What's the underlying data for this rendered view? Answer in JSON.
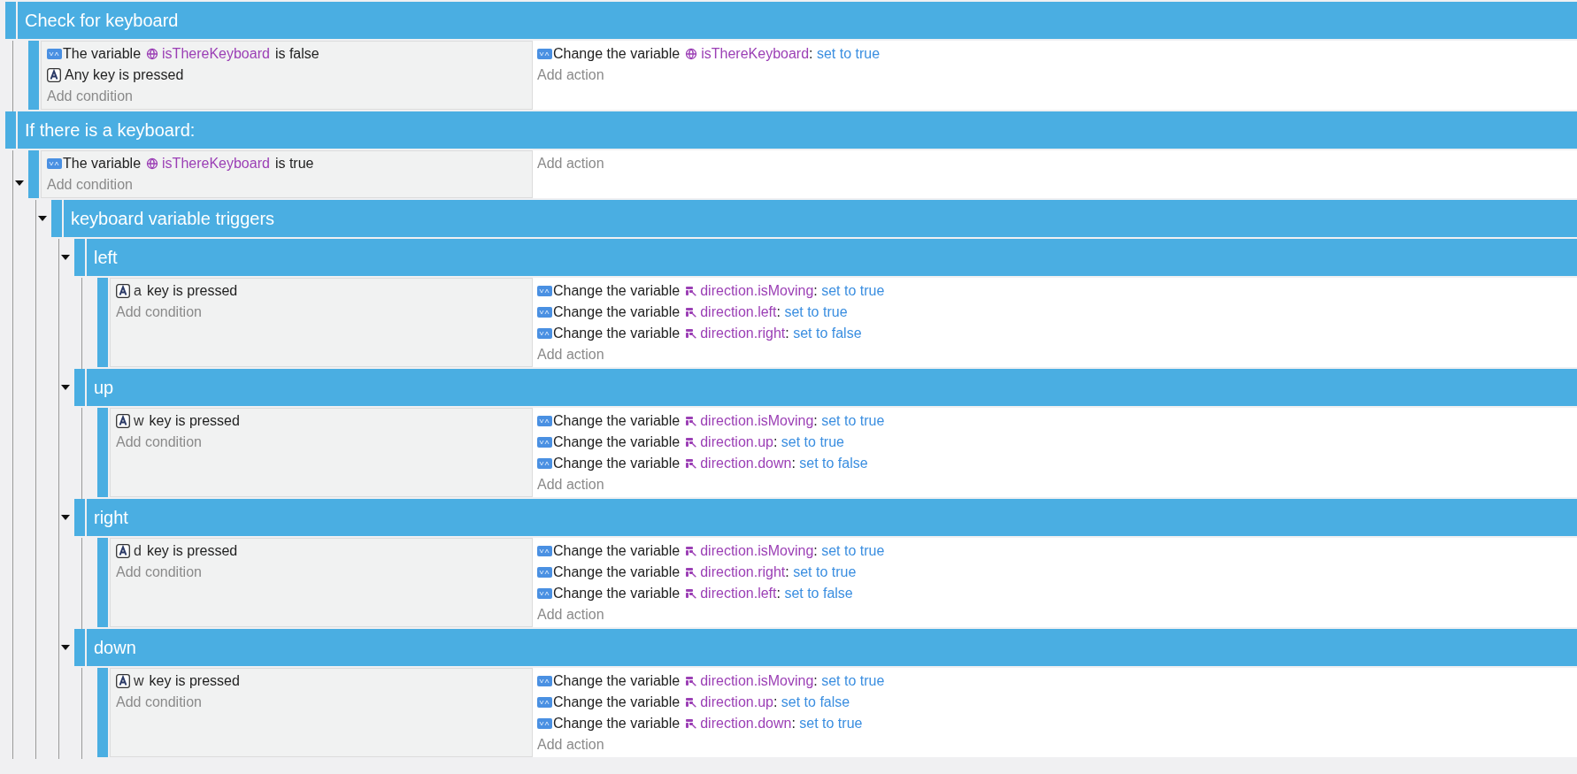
{
  "events": [
    {
      "kind": "group",
      "title": "Check for keyboard",
      "children": [
        {
          "kind": "event",
          "conditions": [
            {
              "kind": "variable",
              "prefix": "The variable",
              "variable": "isThereKeyboard",
              "suffix": "is false"
            },
            {
              "kind": "key",
              "text": "Any key is pressed"
            }
          ],
          "actions": [
            {
              "kind": "global",
              "prefix": "Change the variable",
              "variable": "isThereKeyboard",
              "colon": ":",
              "value": "set to true"
            }
          ],
          "add_condition": "Add condition",
          "add_action": "Add action"
        }
      ]
    },
    {
      "kind": "group",
      "title": "If there is a keyboard:",
      "children": [
        {
          "kind": "event",
          "expanded": true,
          "conditions": [
            {
              "kind": "variable",
              "prefix": "The variable",
              "variable": "isThereKeyboard",
              "suffix": "is true"
            }
          ],
          "add_condition": "Add condition",
          "add_action": "Add action",
          "children": [
            {
              "kind": "group",
              "expanded": true,
              "title": "keyboard variable triggers",
              "children": [
                {
                  "kind": "group",
                  "expanded": true,
                  "title": "left",
                  "children": [
                    {
                      "kind": "event",
                      "conditions": [
                        {
                          "kind": "key",
                          "key": "a",
                          "text": "key is pressed"
                        }
                      ],
                      "actions": [
                        {
                          "kind": "structure",
                          "prefix": "Change the variable",
                          "variable": "direction.isMoving",
                          "colon": ":",
                          "value": "set to true"
                        },
                        {
                          "kind": "structure",
                          "prefix": "Change the variable",
                          "variable": "direction.left",
                          "colon": ":",
                          "value": "set to true"
                        },
                        {
                          "kind": "structure",
                          "prefix": "Change the variable",
                          "variable": "direction.right",
                          "colon": ":",
                          "value": "set to false"
                        }
                      ],
                      "add_condition": "Add condition",
                      "add_action": "Add action"
                    }
                  ]
                },
                {
                  "kind": "group",
                  "expanded": true,
                  "title": "up",
                  "children": [
                    {
                      "kind": "event",
                      "conditions": [
                        {
                          "kind": "key",
                          "key": "w",
                          "text": "key is pressed"
                        }
                      ],
                      "actions": [
                        {
                          "kind": "structure",
                          "prefix": "Change the variable",
                          "variable": "direction.isMoving",
                          "colon": ":",
                          "value": "set to true"
                        },
                        {
                          "kind": "structure",
                          "prefix": "Change the variable",
                          "variable": "direction.up",
                          "colon": ":",
                          "value": "set to true"
                        },
                        {
                          "kind": "structure",
                          "prefix": "Change the variable",
                          "variable": "direction.down",
                          "colon": ":",
                          "value": "set to false"
                        }
                      ],
                      "add_condition": "Add condition",
                      "add_action": "Add action"
                    }
                  ]
                },
                {
                  "kind": "group",
                  "expanded": true,
                  "title": "right",
                  "children": [
                    {
                      "kind": "event",
                      "conditions": [
                        {
                          "kind": "key",
                          "key": "d",
                          "text": "key is pressed"
                        }
                      ],
                      "actions": [
                        {
                          "kind": "structure",
                          "prefix": "Change the variable",
                          "variable": "direction.isMoving",
                          "colon": ":",
                          "value": "set to true"
                        },
                        {
                          "kind": "structure",
                          "prefix": "Change the variable",
                          "variable": "direction.right",
                          "colon": ":",
                          "value": "set to true"
                        },
                        {
                          "kind": "structure",
                          "prefix": "Change the variable",
                          "variable": "direction.left",
                          "colon": ":",
                          "value": "set to false"
                        }
                      ],
                      "add_condition": "Add condition",
                      "add_action": "Add action"
                    }
                  ]
                },
                {
                  "kind": "group",
                  "expanded": true,
                  "title": "down",
                  "children": [
                    {
                      "kind": "event",
                      "conditions": [
                        {
                          "kind": "key",
                          "key": "w",
                          "text": "key is pressed"
                        }
                      ],
                      "actions": [
                        {
                          "kind": "structure",
                          "prefix": "Change the variable",
                          "variable": "direction.isMoving",
                          "colon": ":",
                          "value": "set to true"
                        },
                        {
                          "kind": "structure",
                          "prefix": "Change the variable",
                          "variable": "direction.up",
                          "colon": ":",
                          "value": "set to false"
                        },
                        {
                          "kind": "structure",
                          "prefix": "Change the variable",
                          "variable": "direction.down",
                          "colon": ":",
                          "value": "set to true"
                        }
                      ],
                      "add_condition": "Add condition",
                      "add_action": "Add action"
                    }
                  ]
                }
              ]
            }
          ]
        }
      ]
    }
  ]
}
